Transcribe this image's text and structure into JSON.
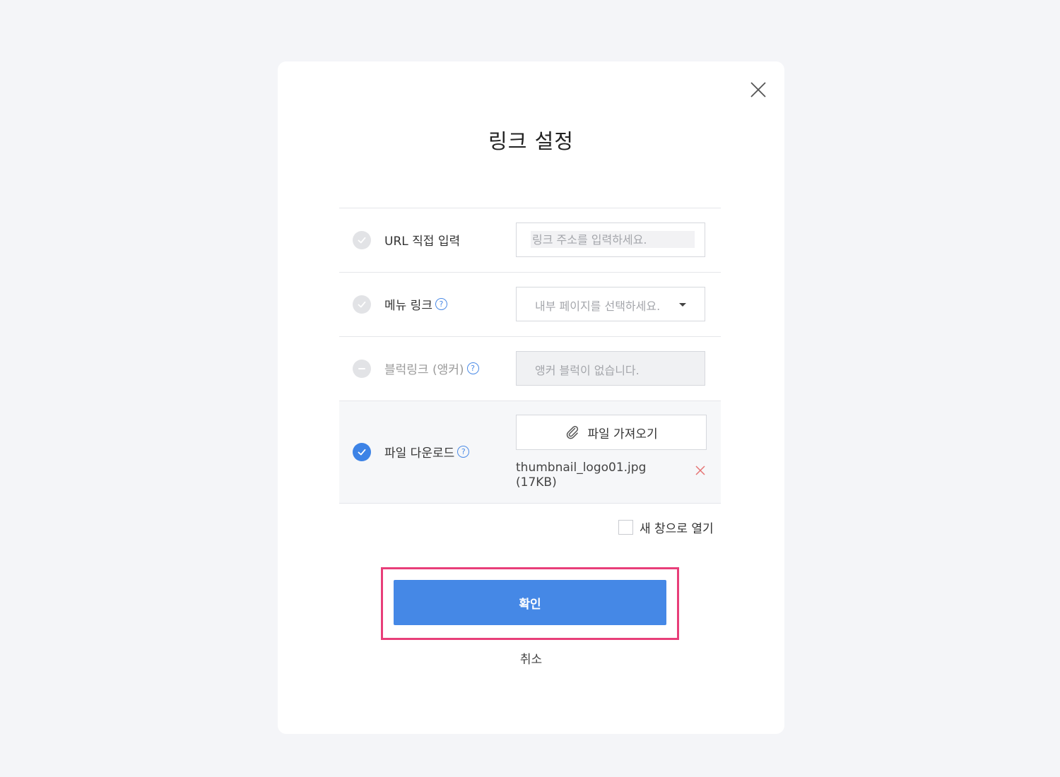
{
  "dialog": {
    "title": "링크 설정",
    "close_icon": "close-icon"
  },
  "options": {
    "url": {
      "label": "URL 직접 입력",
      "placeholder": "링크 주소를 입력하세요.",
      "value": ""
    },
    "menu": {
      "label": "메뉴 링크",
      "select_placeholder": "내부 페이지를 선택하세요."
    },
    "block": {
      "label": "블럭링크 (앵커)",
      "empty_text": "앵커 블럭이 없습니다."
    },
    "file": {
      "label": "파일 다운로드",
      "button_label": "파일 가져오기",
      "file_name": "thumbnail_logo01.jpg",
      "file_size": "(17KB)"
    }
  },
  "new_window": {
    "label": "새 창으로 열기",
    "checked": false
  },
  "actions": {
    "confirm_label": "확인",
    "cancel_label": "취소"
  },
  "colors": {
    "accent": "#4588e6",
    "highlight_border": "#e83e79",
    "remove_icon": "#e57373"
  }
}
